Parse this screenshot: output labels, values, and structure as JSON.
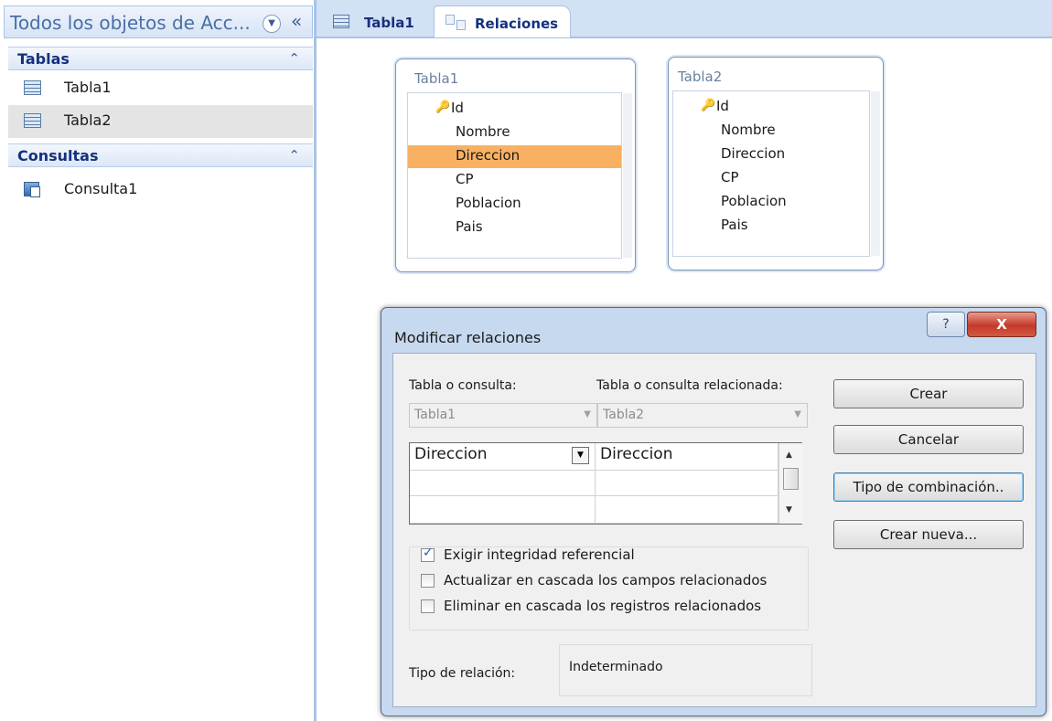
{
  "nav": {
    "title": "Todos los objetos de Acc...",
    "groups": [
      {
        "label": "Tablas",
        "items": [
          {
            "label": "Tabla1"
          },
          {
            "label": "Tabla2"
          }
        ]
      },
      {
        "label": "Consultas",
        "items": [
          {
            "label": "Consulta1"
          }
        ]
      }
    ]
  },
  "tabs": [
    {
      "label": "Tabla1"
    },
    {
      "label": "Relaciones"
    }
  ],
  "diagram": {
    "tables": [
      {
        "title": "Tabla1",
        "fields": [
          "Id",
          "Nombre",
          "Direccion",
          "CP",
          "Poblacion",
          "Pais"
        ],
        "key_field": "Id",
        "highlighted_field": "Direccion"
      },
      {
        "title": "Tabla2",
        "fields": [
          "Id",
          "Nombre",
          "Direccion",
          "CP",
          "Poblacion",
          "Pais"
        ],
        "key_field": "Id"
      }
    ]
  },
  "dialog": {
    "title": "Modificar relaciones",
    "help_label": "?",
    "close_label": "X",
    "table_label": "Tabla o consulta:",
    "related_table_label": "Tabla o consulta relacionada:",
    "table_value": "Tabla1",
    "related_table_value": "Tabla2",
    "grid_rows": [
      {
        "left": "Direccion",
        "right": "Direccion"
      },
      {
        "left": "",
        "right": ""
      },
      {
        "left": "",
        "right": ""
      }
    ],
    "checkboxes": [
      {
        "label": "Exigir integridad referencial",
        "checked": true
      },
      {
        "label": "Actualizar en cascada los campos relacionados",
        "checked": false
      },
      {
        "label": "Eliminar en cascada los registros relacionados",
        "checked": false
      }
    ],
    "relation_type_label": "Tipo de relación:",
    "relation_type_value": "Indeterminado",
    "buttons": {
      "create": "Crear",
      "cancel": "Cancelar",
      "join_type": "Tipo de combinación..",
      "create_new": "Crear nueva..."
    }
  },
  "colors": {
    "accent": "#15317e",
    "highlight": "#f8b163",
    "frame": "#c7d9ef"
  }
}
